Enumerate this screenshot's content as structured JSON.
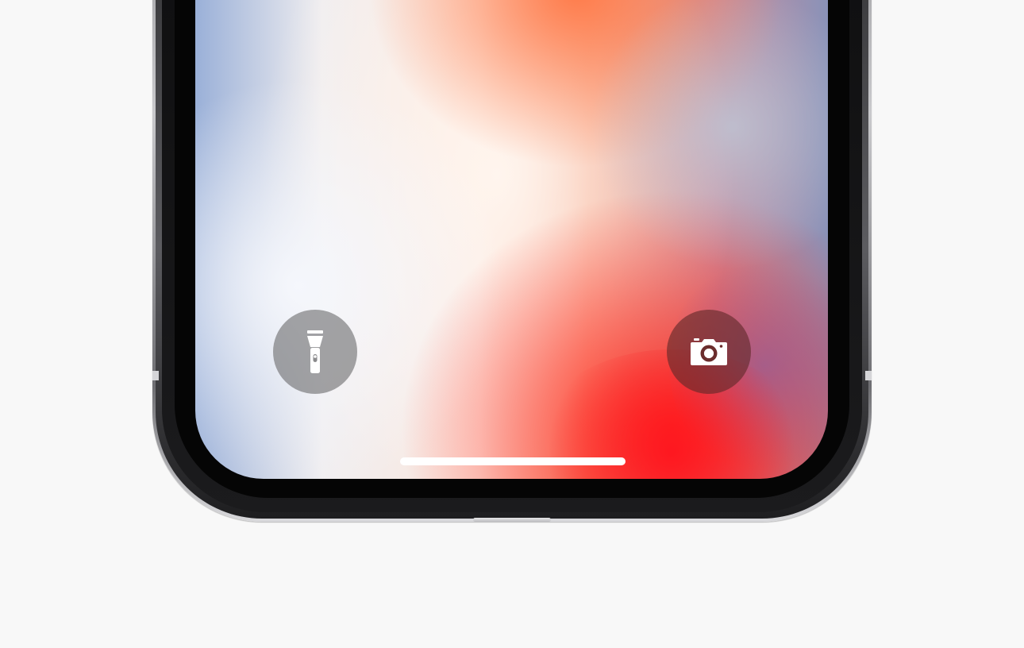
{
  "lock_screen": {
    "quick_actions": [
      {
        "id": "flashlight",
        "icon": "flashlight-icon"
      },
      {
        "id": "camera",
        "icon": "camera-icon"
      }
    ],
    "home_indicator": {
      "icon": "home-indicator-bar"
    }
  },
  "colors": {
    "background": "#f8f8f8",
    "button_glyph": "#ffffff",
    "flashlight_button_bg": "#6e6e70",
    "camera_button_bg": "#5f2828",
    "wallpaper_accent_red": "#ff2a1e",
    "wallpaper_accent_blue": "#9ab0d8"
  }
}
